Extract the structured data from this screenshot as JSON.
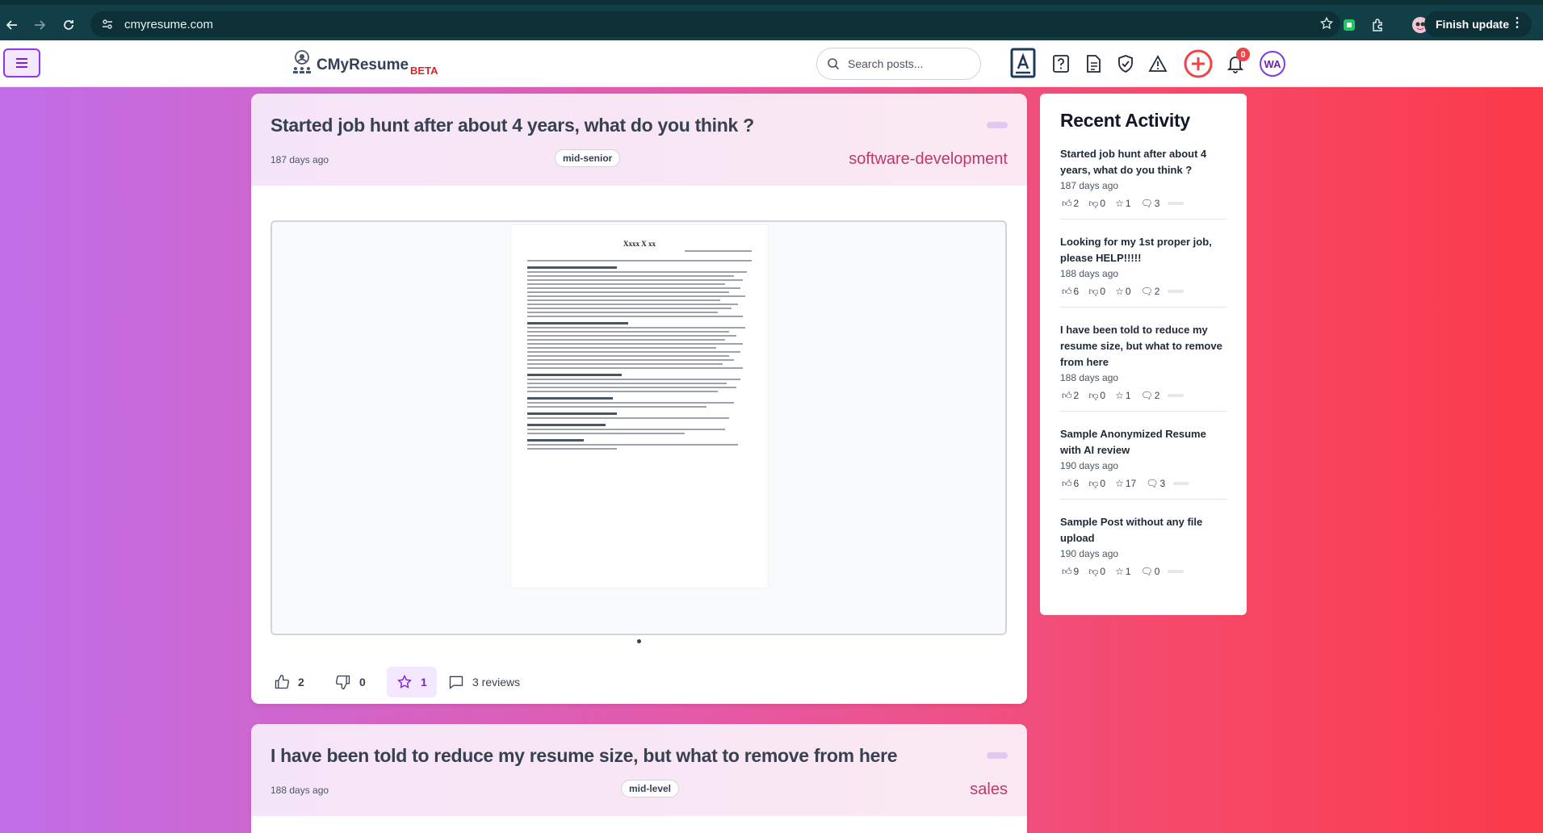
{
  "browser": {
    "url": "cmyresume.com",
    "finish_update": "Finish update"
  },
  "header": {
    "brand": "CMyResume",
    "beta": "BETA",
    "search_placeholder": "Search posts...",
    "notification_count": "0",
    "avatar_initials": "WA",
    "accent_color": "#9333ea"
  },
  "posts": [
    {
      "title": "Started job hunt after about 4 years, what do you think ?",
      "date": "187 days ago",
      "level": "mid-senior",
      "category": "software-development",
      "preview": {
        "name": "Xxxx X xx"
      },
      "likes": "2",
      "dislikes": "0",
      "stars": "1",
      "reviews": "3 reviews"
    },
    {
      "title": "I have been told to reduce my resume size, but what to remove from here",
      "date": "188 days ago",
      "level": "mid-level",
      "category": "sales"
    }
  ],
  "recent_activity": {
    "heading": "Recent Activity",
    "items": [
      {
        "title": "Started job hunt after about 4 years, what do you think ?",
        "date": "187 days ago",
        "likes": "2",
        "dislikes": "0",
        "stars": "1",
        "comments": "3"
      },
      {
        "title": "Looking for my 1st proper job, please HELP!!!!!",
        "date": "188 days ago",
        "likes": "6",
        "dislikes": "0",
        "stars": "0",
        "comments": "2"
      },
      {
        "title": "I have been told to reduce my resume size, but what to remove from here",
        "date": "188 days ago",
        "likes": "2",
        "dislikes": "0",
        "stars": "1",
        "comments": "2"
      },
      {
        "title": "Sample Anonymized Resume with AI review",
        "date": "190 days ago",
        "likes": "6",
        "dislikes": "0",
        "stars": "17",
        "comments": "3"
      },
      {
        "title": "Sample Post without any file upload",
        "date": "190 days ago",
        "likes": "9",
        "dislikes": "0",
        "stars": "1",
        "comments": "0"
      }
    ]
  }
}
